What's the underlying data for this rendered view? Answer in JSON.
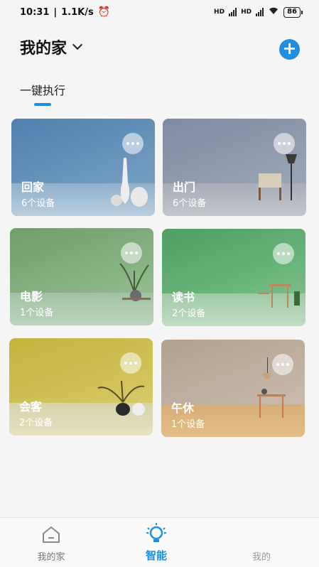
{
  "status_bar": {
    "time": "10:31",
    "speed": "1.1K/s",
    "battery": "86",
    "network_1": "HD",
    "network_2": "HD"
  },
  "header": {
    "title": "我的家",
    "add_icon": "plus-icon"
  },
  "tabs": {
    "active_label": "一键执行"
  },
  "scenes": [
    {
      "name": "回家",
      "count": "6个设备",
      "color": "#5b86ad"
    },
    {
      "name": "出门",
      "count": "6个设备",
      "color": "#8b96aa"
    },
    {
      "name": "电影",
      "count": "1个设备",
      "color": "#7fa77a"
    },
    {
      "name": "读书",
      "count": "2个设备",
      "color": "#5fae72"
    },
    {
      "name": "会客",
      "count": "2个设备",
      "color": "#c7b74a"
    },
    {
      "name": "午休",
      "count": "1个设备",
      "color": "#b9a797"
    }
  ],
  "bottom_nav": {
    "items": [
      {
        "label": "我的家",
        "icon": "home-icon"
      },
      {
        "label": "智能",
        "icon": "lightbulb-icon"
      },
      {
        "label": "我的",
        "icon": "person-icon"
      }
    ]
  },
  "colors": {
    "accent": "#1f8fe5",
    "background": "#f5f5f5"
  }
}
